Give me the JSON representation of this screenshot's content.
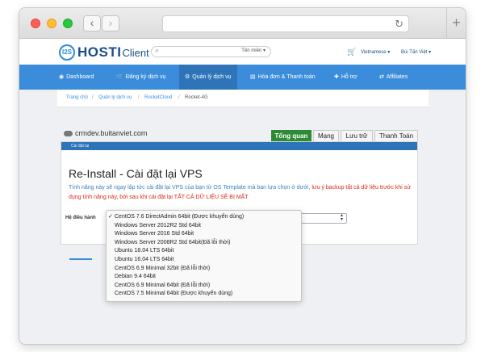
{
  "brand": {
    "badge": "I2S",
    "name": "HOSTI",
    "sub": "Client",
    "accent": "#3b8ddb"
  },
  "header": {
    "search_scope": "Tên miền",
    "language": "Vietnamese",
    "user": "Bùi Tấn Việt"
  },
  "menu": [
    {
      "label": "Dashboard",
      "icon": "dashboard-icon"
    },
    {
      "label": "Đăng ký dịch vụ",
      "icon": "cart-icon"
    },
    {
      "label": "Quản lý dịch vụ",
      "icon": "gear-icon"
    },
    {
      "label": "Hóa đơn & Thanh toán",
      "icon": "invoice-icon"
    },
    {
      "label": "Hỗ trợ",
      "icon": "support-icon"
    },
    {
      "label": "Affiliates",
      "icon": "share-icon"
    }
  ],
  "breadcrumb": [
    "Trang chủ",
    "Quản lý dịch vụ",
    "RocketCloud",
    "Rocket-4G"
  ],
  "service": {
    "hostname": "crmdev.buitanviet.com"
  },
  "tabs": [
    "Tổng quan",
    "Mạng",
    "Lưu trữ",
    "Thanh Toán"
  ],
  "panel": {
    "header": "Cài đặt lại",
    "title": "Re-Install - Cài đặt lại VPS",
    "desc_normal": "Tính năng này sẽ ngay lập tức cài đặt lại VPS của bạn từ OS Template mà bạn lựa chọn ở dưới, ",
    "desc_warn": "lưu ý backup tất cả dữ liệu trước khi sử dụng tính năng này, bởi sau khi cài đặt lại TẤT CẢ DỮ LIỆU SẼ BỊ MẤT",
    "os_label": "Hệ điều hành"
  },
  "os_options": [
    "CentOS 7.6 DirectAdmin 64bit (Được khuyến dùng)",
    "Windows Server 2012R2 Std 64bit",
    "Windows Server 2016 Std 64bit",
    "Windows Server 2008R2 Std 64bit(Đã lỗi thời)",
    "Ubuntu 18.04 LTS 64bit",
    "Ubuntu 16.04 LTS 64bit",
    "CentOS 6.9 Minimal 32bit (Đã lỗi thời)",
    "Debian 9.4 64bit",
    "CentOS 6.9 Minimal 64bit (Đã lỗi thời)",
    "CentOS 7.5 Minimal 64bit (Được khuyến dùng)"
  ],
  "selected_os": "CentOS 7.6 DirectAdmin 64bit (Được khuyến dùng)"
}
